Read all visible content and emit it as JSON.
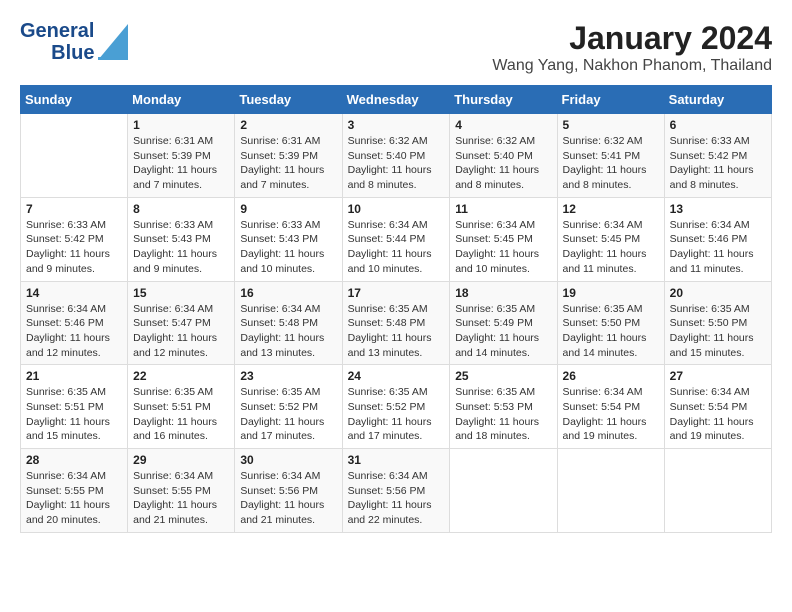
{
  "header": {
    "logo_line1": "General",
    "logo_line2": "Blue",
    "title": "January 2024",
    "subtitle": "Wang Yang, Nakhon Phanom, Thailand"
  },
  "days_of_week": [
    "Sunday",
    "Monday",
    "Tuesday",
    "Wednesday",
    "Thursday",
    "Friday",
    "Saturday"
  ],
  "weeks": [
    [
      {
        "day": "",
        "info": ""
      },
      {
        "day": "1",
        "info": "Sunrise: 6:31 AM\nSunset: 5:39 PM\nDaylight: 11 hours\nand 7 minutes."
      },
      {
        "day": "2",
        "info": "Sunrise: 6:31 AM\nSunset: 5:39 PM\nDaylight: 11 hours\nand 7 minutes."
      },
      {
        "day": "3",
        "info": "Sunrise: 6:32 AM\nSunset: 5:40 PM\nDaylight: 11 hours\nand 8 minutes."
      },
      {
        "day": "4",
        "info": "Sunrise: 6:32 AM\nSunset: 5:40 PM\nDaylight: 11 hours\nand 8 minutes."
      },
      {
        "day": "5",
        "info": "Sunrise: 6:32 AM\nSunset: 5:41 PM\nDaylight: 11 hours\nand 8 minutes."
      },
      {
        "day": "6",
        "info": "Sunrise: 6:33 AM\nSunset: 5:42 PM\nDaylight: 11 hours\nand 8 minutes."
      }
    ],
    [
      {
        "day": "7",
        "info": "Sunrise: 6:33 AM\nSunset: 5:42 PM\nDaylight: 11 hours\nand 9 minutes."
      },
      {
        "day": "8",
        "info": "Sunrise: 6:33 AM\nSunset: 5:43 PM\nDaylight: 11 hours\nand 9 minutes."
      },
      {
        "day": "9",
        "info": "Sunrise: 6:33 AM\nSunset: 5:43 PM\nDaylight: 11 hours\nand 10 minutes."
      },
      {
        "day": "10",
        "info": "Sunrise: 6:34 AM\nSunset: 5:44 PM\nDaylight: 11 hours\nand 10 minutes."
      },
      {
        "day": "11",
        "info": "Sunrise: 6:34 AM\nSunset: 5:45 PM\nDaylight: 11 hours\nand 10 minutes."
      },
      {
        "day": "12",
        "info": "Sunrise: 6:34 AM\nSunset: 5:45 PM\nDaylight: 11 hours\nand 11 minutes."
      },
      {
        "day": "13",
        "info": "Sunrise: 6:34 AM\nSunset: 5:46 PM\nDaylight: 11 hours\nand 11 minutes."
      }
    ],
    [
      {
        "day": "14",
        "info": "Sunrise: 6:34 AM\nSunset: 5:46 PM\nDaylight: 11 hours\nand 12 minutes."
      },
      {
        "day": "15",
        "info": "Sunrise: 6:34 AM\nSunset: 5:47 PM\nDaylight: 11 hours\nand 12 minutes."
      },
      {
        "day": "16",
        "info": "Sunrise: 6:34 AM\nSunset: 5:48 PM\nDaylight: 11 hours\nand 13 minutes."
      },
      {
        "day": "17",
        "info": "Sunrise: 6:35 AM\nSunset: 5:48 PM\nDaylight: 11 hours\nand 13 minutes."
      },
      {
        "day": "18",
        "info": "Sunrise: 6:35 AM\nSunset: 5:49 PM\nDaylight: 11 hours\nand 14 minutes."
      },
      {
        "day": "19",
        "info": "Sunrise: 6:35 AM\nSunset: 5:50 PM\nDaylight: 11 hours\nand 14 minutes."
      },
      {
        "day": "20",
        "info": "Sunrise: 6:35 AM\nSunset: 5:50 PM\nDaylight: 11 hours\nand 15 minutes."
      }
    ],
    [
      {
        "day": "21",
        "info": "Sunrise: 6:35 AM\nSunset: 5:51 PM\nDaylight: 11 hours\nand 15 minutes."
      },
      {
        "day": "22",
        "info": "Sunrise: 6:35 AM\nSunset: 5:51 PM\nDaylight: 11 hours\nand 16 minutes."
      },
      {
        "day": "23",
        "info": "Sunrise: 6:35 AM\nSunset: 5:52 PM\nDaylight: 11 hours\nand 17 minutes."
      },
      {
        "day": "24",
        "info": "Sunrise: 6:35 AM\nSunset: 5:52 PM\nDaylight: 11 hours\nand 17 minutes."
      },
      {
        "day": "25",
        "info": "Sunrise: 6:35 AM\nSunset: 5:53 PM\nDaylight: 11 hours\nand 18 minutes."
      },
      {
        "day": "26",
        "info": "Sunrise: 6:34 AM\nSunset: 5:54 PM\nDaylight: 11 hours\nand 19 minutes."
      },
      {
        "day": "27",
        "info": "Sunrise: 6:34 AM\nSunset: 5:54 PM\nDaylight: 11 hours\nand 19 minutes."
      }
    ],
    [
      {
        "day": "28",
        "info": "Sunrise: 6:34 AM\nSunset: 5:55 PM\nDaylight: 11 hours\nand 20 minutes."
      },
      {
        "day": "29",
        "info": "Sunrise: 6:34 AM\nSunset: 5:55 PM\nDaylight: 11 hours\nand 21 minutes."
      },
      {
        "day": "30",
        "info": "Sunrise: 6:34 AM\nSunset: 5:56 PM\nDaylight: 11 hours\nand 21 minutes."
      },
      {
        "day": "31",
        "info": "Sunrise: 6:34 AM\nSunset: 5:56 PM\nDaylight: 11 hours\nand 22 minutes."
      },
      {
        "day": "",
        "info": ""
      },
      {
        "day": "",
        "info": ""
      },
      {
        "day": "",
        "info": ""
      }
    ]
  ]
}
